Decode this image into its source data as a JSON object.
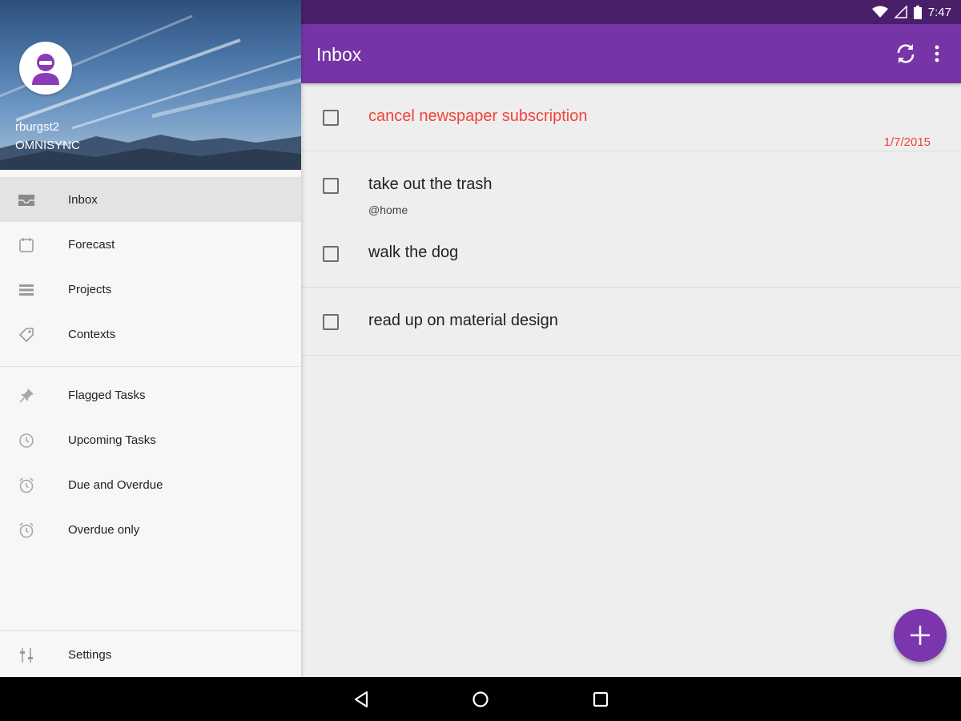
{
  "status_bar": {
    "time": "7:47"
  },
  "drawer": {
    "account": {
      "name": "rburgst2",
      "server": "OMNISYNC"
    },
    "primary_items": [
      {
        "label": "Inbox",
        "icon": "inbox-icon",
        "selected": true
      },
      {
        "label": "Forecast",
        "icon": "calendar-icon",
        "selected": false
      },
      {
        "label": "Projects",
        "icon": "list-icon",
        "selected": false
      },
      {
        "label": "Contexts",
        "icon": "tag-icon",
        "selected": false
      }
    ],
    "secondary_items": [
      {
        "label": "Flagged Tasks",
        "icon": "pin-icon"
      },
      {
        "label": "Upcoming Tasks",
        "icon": "clock-icon"
      },
      {
        "label": "Due and Overdue",
        "icon": "alarm-icon"
      },
      {
        "label": "Overdue only",
        "icon": "alarm-icon"
      }
    ],
    "settings_label": "Settings"
  },
  "app_bar": {
    "title": "Inbox"
  },
  "tasks": [
    {
      "title": "cancel newspaper subscription",
      "due_date": "1/7/2015",
      "overdue": true,
      "context": "",
      "has_note": false
    },
    {
      "title": "take out the trash",
      "due_date": "",
      "overdue": false,
      "context": "@home",
      "has_note": true
    },
    {
      "title": "walk the dog",
      "due_date": "",
      "overdue": false,
      "context": "",
      "has_note": false
    },
    {
      "title": "read up on material design",
      "due_date": "",
      "overdue": false,
      "context": "",
      "has_note": false
    }
  ],
  "colors": {
    "primary": "#7634a6",
    "status_bar": "#4a1f6a",
    "overdue": "#f04438",
    "fab": "#7b35ad"
  }
}
